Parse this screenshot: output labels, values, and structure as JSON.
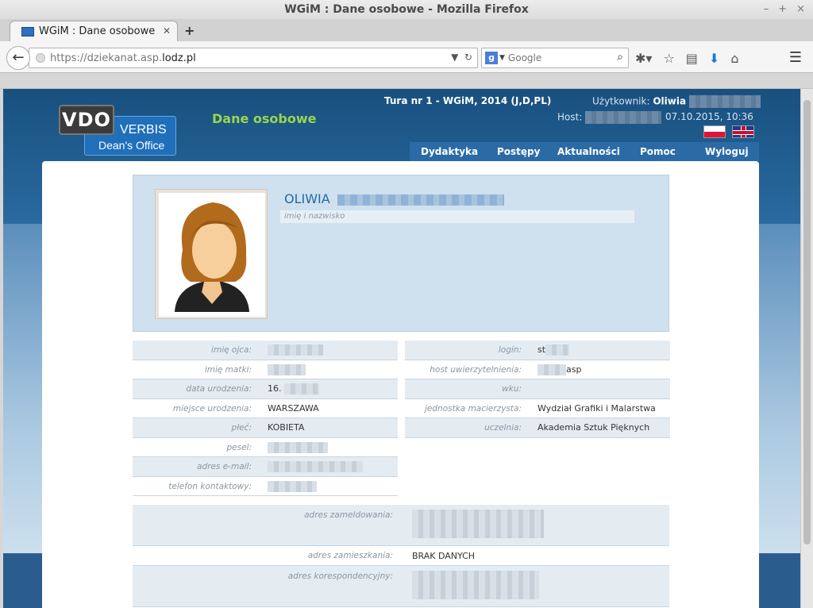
{
  "browser": {
    "window_title": "WGiM : Dane osobowe - Mozilla Firefox",
    "tab_title": "WGiM : Dane osobowe",
    "url_prefix": "https://dziekanat.asp.",
    "url_domain": "lodz.pl",
    "search_placeholder": "Google"
  },
  "header": {
    "logo_vdo": "VDO",
    "logo_verbis": "VERBIS",
    "logo_deans_office": "Dean's Office",
    "page_title": "Dane osobowe",
    "tura": "Tura nr 1 - WGiM, 2014 (J,D,PL)",
    "user_label": "Użytkownik:",
    "user_name": "Oliwia",
    "host_label": "Host:",
    "datetime": "07.10.2015, 10:36"
  },
  "nav": {
    "items": [
      "Dydaktyka",
      "Postępy",
      "Aktualności",
      "Pomoc",
      "Wyloguj"
    ]
  },
  "profile": {
    "name": "OLIWIA",
    "name_caption": "imię i nazwisko"
  },
  "left_fields": [
    {
      "label": "imię ojca:",
      "value": ""
    },
    {
      "label": "imię matki:",
      "value": ""
    },
    {
      "label": "data urodzenia:",
      "value": "16."
    },
    {
      "label": "miejsce urodzenia:",
      "value": "WARSZAWA"
    },
    {
      "label": "płeć:",
      "value": "KOBIETA"
    },
    {
      "label": "pesel:",
      "value": ""
    },
    {
      "label": "adres e-mail:",
      "value": ""
    },
    {
      "label": "telefon kontaktowy:",
      "value": ""
    }
  ],
  "right_fields": [
    {
      "label": "login:",
      "value": "st"
    },
    {
      "label": "host uwierzytelnienia:",
      "value": "asp"
    },
    {
      "label": "wku:",
      "value": ""
    },
    {
      "label": "jednostka macierzysta:",
      "value": "Wydział Grafiki i Malarstwa"
    },
    {
      "label": "uczelnia:",
      "value": "Akademia Sztuk Pięknych"
    }
  ],
  "address": [
    {
      "label": "adres zameldowania:",
      "value": ""
    },
    {
      "label": "adres zamieszkania:",
      "value": "BRAK DANYCH"
    },
    {
      "label": "adres korespondencyjny:",
      "value": ""
    }
  ],
  "colors": {
    "header_bg": "#18507f",
    "title_green": "#9bd64a",
    "name_blue": "#1f6aa8",
    "nav_bg": "#2a6ba6"
  }
}
